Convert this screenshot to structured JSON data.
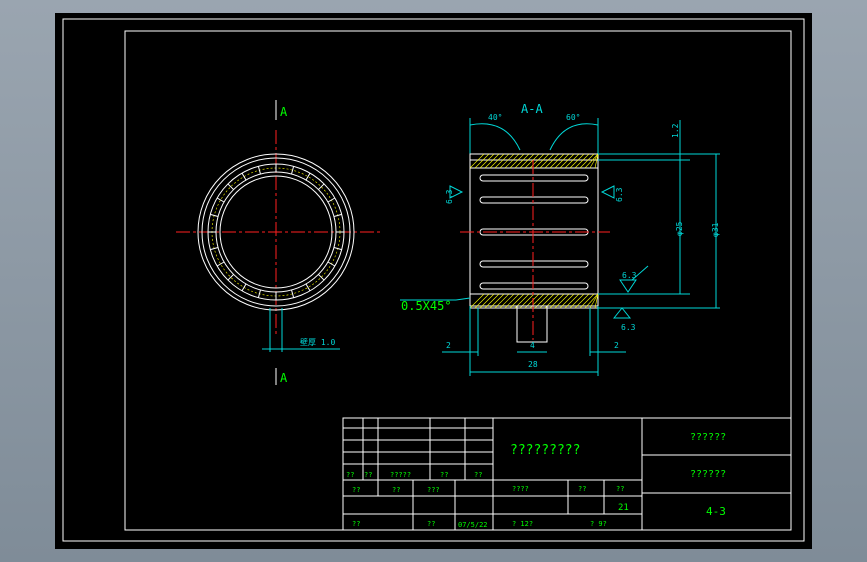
{
  "drawing": {
    "section_label_top": "A",
    "section_label_bottom": "A",
    "section_title": "A-A",
    "left_dim": "壁厚 1.0",
    "chamfer_note": "0.5X45°",
    "angle_left": "40°",
    "angle_right": "60°",
    "dim_top_right": "1.2",
    "dim_inner_dia": "φ25",
    "dim_outer_dia": "φ31",
    "rough_left": "6.3",
    "rough_right": "6.3",
    "rough_bottom_right": "6.3",
    "rough_bottom_right2": "6.3",
    "dim_bottom_left": "2",
    "dim_bottom_center": "4",
    "dim_bottom_right": "2",
    "dim_overall_width": "28"
  },
  "title_block": {
    "part_name": "?????????",
    "company": "??????",
    "drawing_no_label": "??????",
    "drawing_no": "4-3",
    "row_labels": [
      "??",
      "??",
      "?????",
      "??",
      "??"
    ],
    "sign_row": [
      "??",
      "??",
      "???"
    ],
    "design_row": [
      "??",
      "??",
      "07/5/22"
    ],
    "stage_label": "????",
    "weight_label": "??",
    "scale_label": "??",
    "scale_value": "21",
    "sheet_total": "? 12?",
    "sheet_no": "? 9?"
  }
}
